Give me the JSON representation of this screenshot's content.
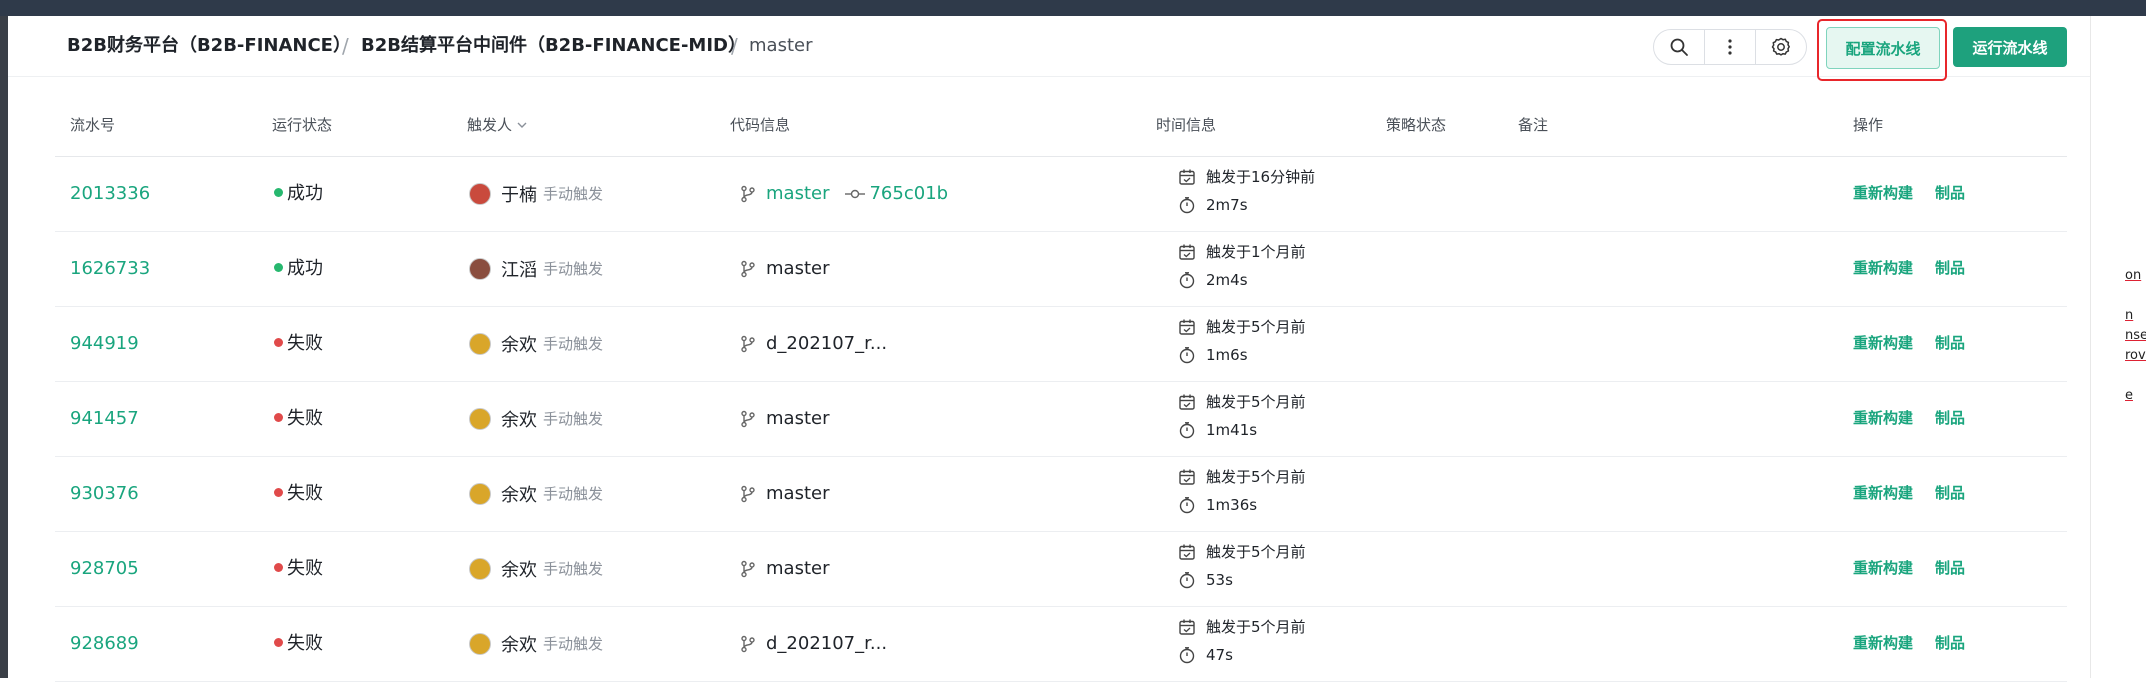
{
  "breadcrumb": {
    "org": "B2B财务平台（B2B-FINANCE）",
    "project": "B2B结算平台中间件（B2B-FINANCE-MID）",
    "branch": "master",
    "separator": "/"
  },
  "toolbar": {
    "icons": [
      "search-icon",
      "more-vertical-icon",
      "settings-icon"
    ],
    "config_label": "配置流水线",
    "run_label": "运行流水线"
  },
  "table": {
    "headers": {
      "run_id": "流水号",
      "status": "运行状态",
      "trigger": "触发人",
      "code": "代码信息",
      "time": "时间信息",
      "policy": "策略状态",
      "note": "备注",
      "ops": "操作"
    },
    "rows": [
      {
        "id": "2013336",
        "status": "成功",
        "status_type": "success",
        "user": "于楠",
        "mode": "手动触发",
        "branch": "master",
        "branch_link": true,
        "commit": "765c01b",
        "triggered": "触发于16分钟前",
        "duration": "2m7s",
        "op1": "重新构建",
        "op2": "制品",
        "avatar_color": "#c94a3d"
      },
      {
        "id": "1626733",
        "status": "成功",
        "status_type": "success",
        "user": "江滔",
        "mode": "手动触发",
        "branch": "master",
        "branch_link": false,
        "commit": "",
        "triggered": "触发于1个月前",
        "duration": "2m4s",
        "op1": "重新构建",
        "op2": "制品",
        "avatar_color": "#8a4e3f"
      },
      {
        "id": "944919",
        "status": "失败",
        "status_type": "fail",
        "user": "余欢",
        "mode": "手动触发",
        "branch": "d_202107_r...",
        "branch_link": false,
        "commit": "",
        "triggered": "触发于5个月前",
        "duration": "1m6s",
        "op1": "重新构建",
        "op2": "制品",
        "avatar_color": "#d9a62a"
      },
      {
        "id": "941457",
        "status": "失败",
        "status_type": "fail",
        "user": "余欢",
        "mode": "手动触发",
        "branch": "master",
        "branch_link": false,
        "commit": "",
        "triggered": "触发于5个月前",
        "duration": "1m41s",
        "op1": "重新构建",
        "op2": "制品",
        "avatar_color": "#d9a62a"
      },
      {
        "id": "930376",
        "status": "失败",
        "status_type": "fail",
        "user": "余欢",
        "mode": "手动触发",
        "branch": "master",
        "branch_link": false,
        "commit": "",
        "triggered": "触发于5个月前",
        "duration": "1m36s",
        "op1": "重新构建",
        "op2": "制品",
        "avatar_color": "#d9a62a"
      },
      {
        "id": "928705",
        "status": "失败",
        "status_type": "fail",
        "user": "余欢",
        "mode": "手动触发",
        "branch": "master",
        "branch_link": false,
        "commit": "",
        "triggered": "触发于5个月前",
        "duration": "53s",
        "op1": "重新构建",
        "op2": "制品",
        "avatar_color": "#d9a62a"
      },
      {
        "id": "928689",
        "status": "失败",
        "status_type": "fail",
        "user": "余欢",
        "mode": "手动触发",
        "branch": "d_202107_r...",
        "branch_link": false,
        "commit": "",
        "triggered": "触发于5个月前",
        "duration": "47s",
        "op1": "重新构建",
        "op2": "制品",
        "avatar_color": "#d9a62a"
      }
    ]
  },
  "right_fragments": [
    "on",
    "n",
    "nse",
    "rovi",
    "e"
  ],
  "colors": {
    "accent": "#1aa57e",
    "success": "#27b86f",
    "fail": "#e04a4a",
    "highlight": "#e8262b"
  }
}
